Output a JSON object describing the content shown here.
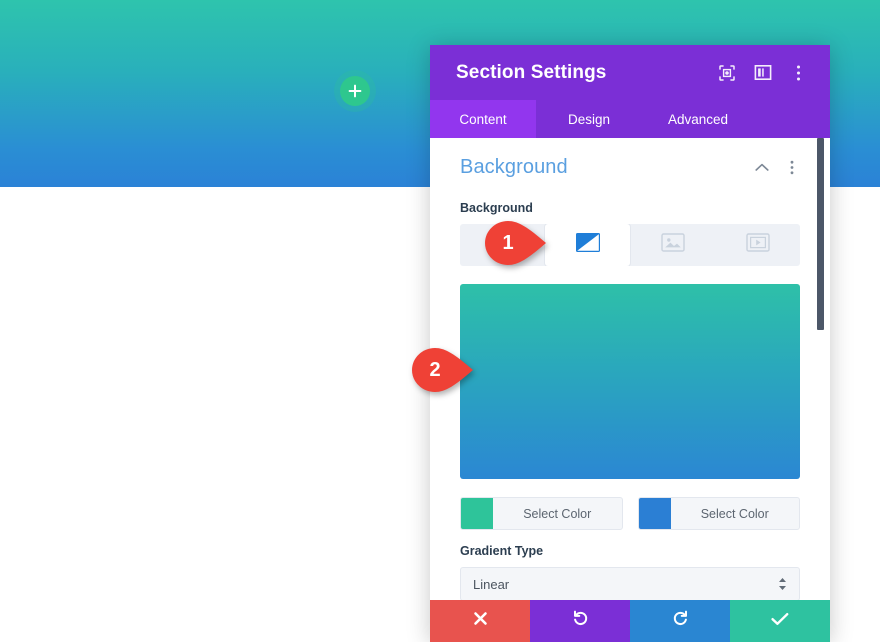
{
  "page": {
    "hero_gradient_start": "#2ec4ad",
    "hero_gradient_end": "#2b82d6",
    "add_section_icon": "plus-icon"
  },
  "panel": {
    "title": "Section Settings",
    "header_icons": [
      {
        "name": "focus-target-icon"
      },
      {
        "name": "layout-columns-icon"
      },
      {
        "name": "more-vertical-icon"
      }
    ],
    "tabs": [
      {
        "label": "Content",
        "active": true
      },
      {
        "label": "Design",
        "active": false
      },
      {
        "label": "Advanced",
        "active": false
      }
    ],
    "accent_color": "#7b2fd6",
    "tab_active_color": "#9236ee"
  },
  "section": {
    "title": "Background",
    "collapse_icon": "chevron-up-icon",
    "more_icon": "more-vertical-icon",
    "field_label": "Background",
    "bg_types": [
      {
        "name": "background-color-tab",
        "icon": "color-swatch-icon",
        "active": false
      },
      {
        "name": "background-gradient-tab",
        "icon": "gradient-icon",
        "active": true
      },
      {
        "name": "background-image-tab",
        "icon": "image-icon",
        "active": false
      },
      {
        "name": "background-video-tab",
        "icon": "video-icon",
        "active": false
      }
    ],
    "gradient_preview": {
      "start": "#2ec0a8",
      "end": "#2b87d3"
    },
    "colors": [
      {
        "swatch": "#2ec49a",
        "label": "Select Color"
      },
      {
        "swatch": "#2b7fd4",
        "label": "Select Color"
      }
    ],
    "gradient_type_label": "Gradient Type",
    "gradient_type_value": "Linear"
  },
  "actions": [
    {
      "name": "cancel-button",
      "icon": "close-icon",
      "color": "#e8534e"
    },
    {
      "name": "undo-button",
      "icon": "undo-icon",
      "color": "#7b2fd6"
    },
    {
      "name": "redo-button",
      "icon": "redo-icon",
      "color": "#2a86d2"
    },
    {
      "name": "save-button",
      "icon": "check-icon",
      "color": "#2ec2a0"
    }
  ],
  "markers": [
    {
      "label": "1",
      "color": "#ef4136"
    },
    {
      "label": "2",
      "color": "#ef4136"
    }
  ]
}
